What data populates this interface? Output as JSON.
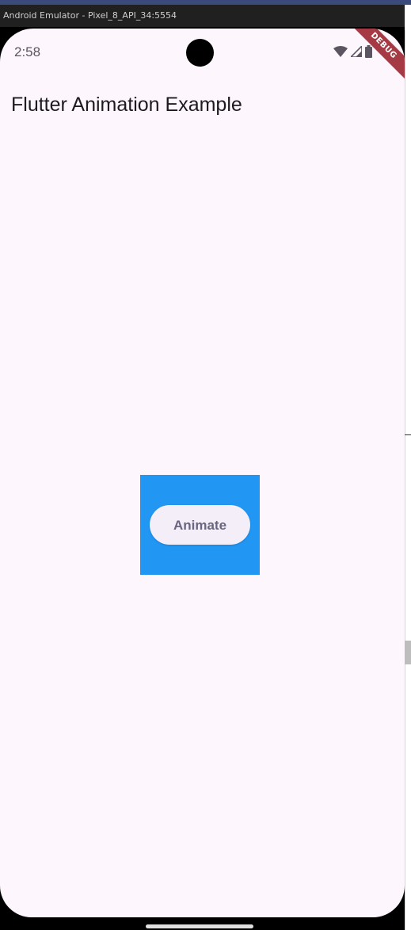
{
  "window": {
    "title": "Android Emulator - Pixel_8_API_34:5554"
  },
  "status_bar": {
    "time": "2:58",
    "icons": [
      "wifi-icon",
      "cell-signal-icon",
      "battery-icon"
    ]
  },
  "debug_banner": {
    "label": "DEBUG",
    "color": "#a53a45"
  },
  "app_bar": {
    "title": "Flutter Animation Example"
  },
  "animated_box": {
    "color": "#2196f3",
    "button_label": "Animate"
  },
  "colors": {
    "screen_background": "#fdf6fd",
    "button_background": "#f3eef7",
    "button_text": "#6a6580"
  }
}
